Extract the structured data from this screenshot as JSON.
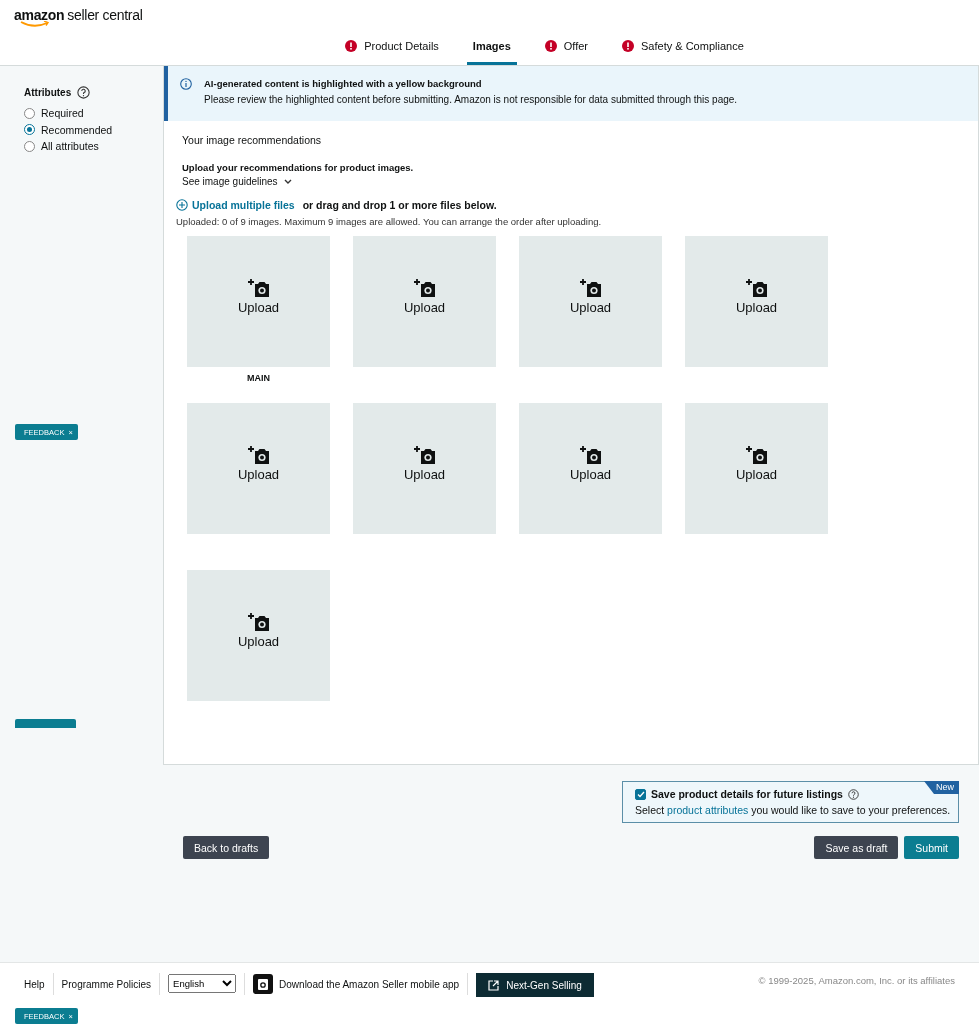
{
  "header": {
    "logo_bold": "amazon",
    "logo_rest": "seller central"
  },
  "tabs": [
    {
      "label": "Product Details",
      "selected": false,
      "error": true
    },
    {
      "label": "Images",
      "selected": true,
      "error": false
    },
    {
      "label": "Offer",
      "selected": false,
      "error": true
    },
    {
      "label": "Safety & Compliance",
      "selected": false,
      "error": true
    }
  ],
  "sidebar": {
    "title": "Attributes",
    "options": [
      {
        "label": "Required",
        "selected": false
      },
      {
        "label": "Recommended",
        "selected": true
      },
      {
        "label": "All attributes",
        "selected": false
      }
    ]
  },
  "banner": {
    "title": "AI-generated content is highlighted with a yellow background",
    "text": "Please review the highlighted content before submitting. Amazon is not responsible for data submitted through this page."
  },
  "images": {
    "heading": "Your image recommendations",
    "subheading": "Upload your recommendations for product images.",
    "guidelines": "See image guidelines",
    "upload_link": "Upload multiple files",
    "upload_hint": "or drag and drop 1 or more files below.",
    "status": "Uploaded: 0 of 9 images. Maximum 9 images are allowed. You can arrange the order after uploading.",
    "slots": [
      {
        "label": "Upload",
        "caption": "MAIN"
      },
      {
        "label": "Upload"
      },
      {
        "label": "Upload"
      },
      {
        "label": "Upload"
      },
      {
        "label": "Upload"
      },
      {
        "label": "Upload"
      },
      {
        "label": "Upload"
      },
      {
        "label": "Upload"
      },
      {
        "label": "Upload"
      }
    ]
  },
  "save_box": {
    "checked": true,
    "title": "Save product details for future listings",
    "badge": "New",
    "text_before": "Select",
    "link": "product attributes",
    "text_after": "you would like to save to your preferences."
  },
  "buttons": {
    "back": "Back to drafts",
    "draft": "Save as draft",
    "submit": "Submit"
  },
  "feedback_tabs": [
    {
      "label": "FEEDBACK",
      "close": "×",
      "clipped": false
    },
    {
      "clipped": true
    },
    {
      "label": "FEEDBACK",
      "close": "×",
      "clipped": false
    }
  ],
  "footer": {
    "links": [
      "Help",
      "Programme Policies"
    ],
    "language": "English",
    "app": "Download the Amazon Seller mobile app",
    "next_gen": "Next-Gen Selling",
    "copyright": "© 1999-2025, Amazon.com, Inc. or its affiliates"
  }
}
